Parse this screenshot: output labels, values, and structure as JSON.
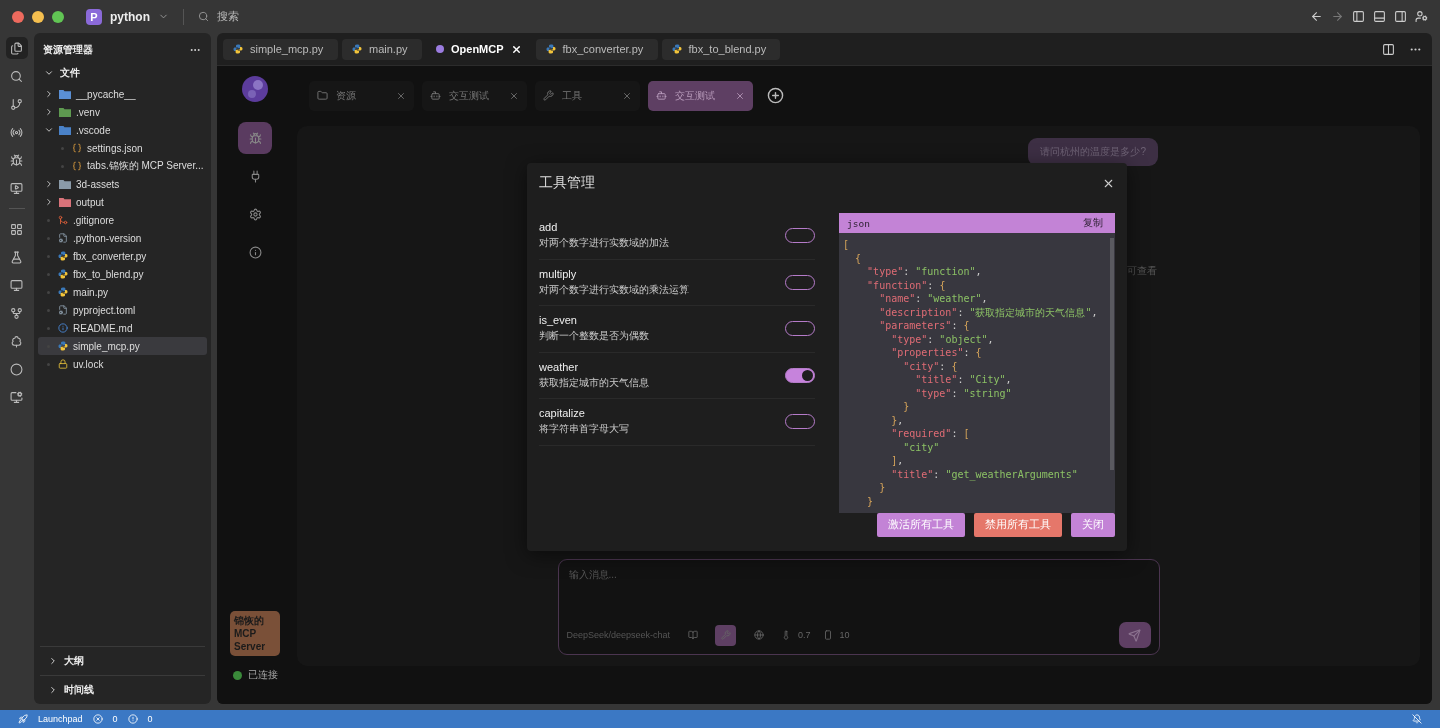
{
  "title_bar": {
    "project_badge": "P",
    "project": "python",
    "search": "搜索"
  },
  "activity_bar": [
    {
      "selected": true
    },
    {
      "selected": false
    },
    {
      "selected": false
    },
    {
      "selected": false
    },
    {
      "selected": false
    },
    {
      "selected": false
    },
    {
      "selected": false
    },
    {
      "selected": false
    },
    {
      "selected": false
    },
    {
      "selected": false
    },
    {
      "selected": false
    },
    {
      "selected": false
    },
    {
      "selected": false
    }
  ],
  "sidebar": {
    "title": "资源管理器",
    "section": "文件",
    "items": [
      {
        "label": "__pycache__",
        "kind": "folder-python",
        "expanded": false,
        "selected": false
      },
      {
        "label": ".venv",
        "kind": "folder-venv",
        "expanded": false,
        "selected": false
      },
      {
        "label": ".vscode",
        "kind": "folder-vscode",
        "expanded": true,
        "selected": false,
        "children": [
          {
            "label": "settings.json",
            "kind": "json",
            "selected": false
          },
          {
            "label": "tabs.锦恢的 MCP Server...",
            "kind": "json",
            "selected": false
          }
        ]
      },
      {
        "label": "3d-assets",
        "kind": "folder",
        "expanded": false,
        "selected": false
      },
      {
        "label": "output",
        "kind": "folder-output",
        "expanded": false,
        "selected": false
      },
      {
        "label": ".gitignore",
        "kind": "git",
        "selected": false
      },
      {
        "label": ".python-version",
        "kind": "config",
        "selected": false
      },
      {
        "label": "fbx_converter.py",
        "kind": "python",
        "selected": false
      },
      {
        "label": "fbx_to_blend.py",
        "kind": "python",
        "selected": false
      },
      {
        "label": "main.py",
        "kind": "python",
        "selected": false
      },
      {
        "label": "pyproject.toml",
        "kind": "config",
        "selected": false
      },
      {
        "label": "README.md",
        "kind": "info",
        "selected": false
      },
      {
        "label": "simple_mcp.py",
        "kind": "python",
        "selected": true
      },
      {
        "label": "uv.lock",
        "kind": "lock",
        "selected": false
      }
    ],
    "panels": [
      {
        "label": "大纲",
        "expanded": false
      },
      {
        "label": "时间线",
        "expanded": false
      }
    ]
  },
  "editor_tabs": [
    {
      "label": "simple_mcp.py",
      "kind": "python",
      "selected": false
    },
    {
      "label": "main.py",
      "kind": "python",
      "selected": false
    },
    {
      "label": "OpenMCP",
      "kind": "openmcp",
      "selected": true
    },
    {
      "label": "fbx_converter.py",
      "kind": "python",
      "selected": false
    },
    {
      "label": "fbx_to_blend.py",
      "kind": "python",
      "selected": false
    }
  ],
  "rail": {
    "nav": [
      {
        "kind": "bug",
        "selected": true
      },
      {
        "kind": "plug",
        "selected": false
      },
      {
        "kind": "gear",
        "selected": false
      },
      {
        "kind": "info",
        "selected": false
      }
    ],
    "server": "锦恢的 MCP Server",
    "status": "已连接",
    "connected": true
  },
  "inner_tabs": [
    {
      "label": "资源",
      "kind": "folder",
      "selected": false
    },
    {
      "label": "交互测试",
      "kind": "bot",
      "selected": false
    },
    {
      "label": "工具",
      "kind": "wrench",
      "selected": false
    },
    {
      "label": "交互测试",
      "kind": "bot",
      "selected": true
    }
  ],
  "chat": {
    "user_message": "请问杭州的温度是多少?",
    "hint_fragment": "可查看",
    "input": {
      "placeholder": "输入消息...",
      "model": "DeepSeek/deepseek-chat",
      "tools": [
        {
          "kind": "book",
          "selected": false
        },
        {
          "kind": "wrench",
          "selected": true
        },
        {
          "kind": "globe",
          "selected": false
        },
        {
          "kind": "thermometer",
          "value": "0.7",
          "selected": false
        },
        {
          "kind": "context",
          "value": "10",
          "selected": false
        }
      ]
    }
  },
  "modal": {
    "title": "工具管理",
    "tools": [
      {
        "name": "add",
        "description": "对两个数字进行实数域的加法",
        "enabled": false
      },
      {
        "name": "multiply",
        "description": "对两个数字进行实数域的乘法运算",
        "enabled": false
      },
      {
        "name": "is_even",
        "description": "判断一个整数是否为偶数",
        "enabled": false
      },
      {
        "name": "weather",
        "description": "获取指定城市的天气信息",
        "enabled": true
      },
      {
        "name": "capitalize",
        "description": "将字符串首字母大写",
        "enabled": false
      }
    ],
    "code": {
      "language": "json",
      "copy": "复制",
      "lines": [
        "[",
        "  {",
        "    \"type\": \"function\",",
        "    \"function\": {",
        "      \"name\": \"weather\",",
        "      \"description\": \"获取指定城市的天气信息\",",
        "      \"parameters\": {",
        "        \"type\": \"object\",",
        "        \"properties\": {",
        "          \"city\": {",
        "            \"title\": \"City\",",
        "            \"type\": \"string\"",
        "          }",
        "        },",
        "        \"required\": [",
        "          \"city\"",
        "        ],",
        "        \"title\": \"get_weatherArguments\"",
        "      }",
        "    }"
      ]
    },
    "buttons": [
      {
        "label": "激活所有工具",
        "kind": "primary"
      },
      {
        "label": "禁用所有工具",
        "kind": "danger"
      },
      {
        "label": "关闭",
        "kind": "primary"
      }
    ]
  },
  "status_bar": {
    "launchpad": "Launchpad",
    "errors": "0",
    "warnings": "0"
  }
}
